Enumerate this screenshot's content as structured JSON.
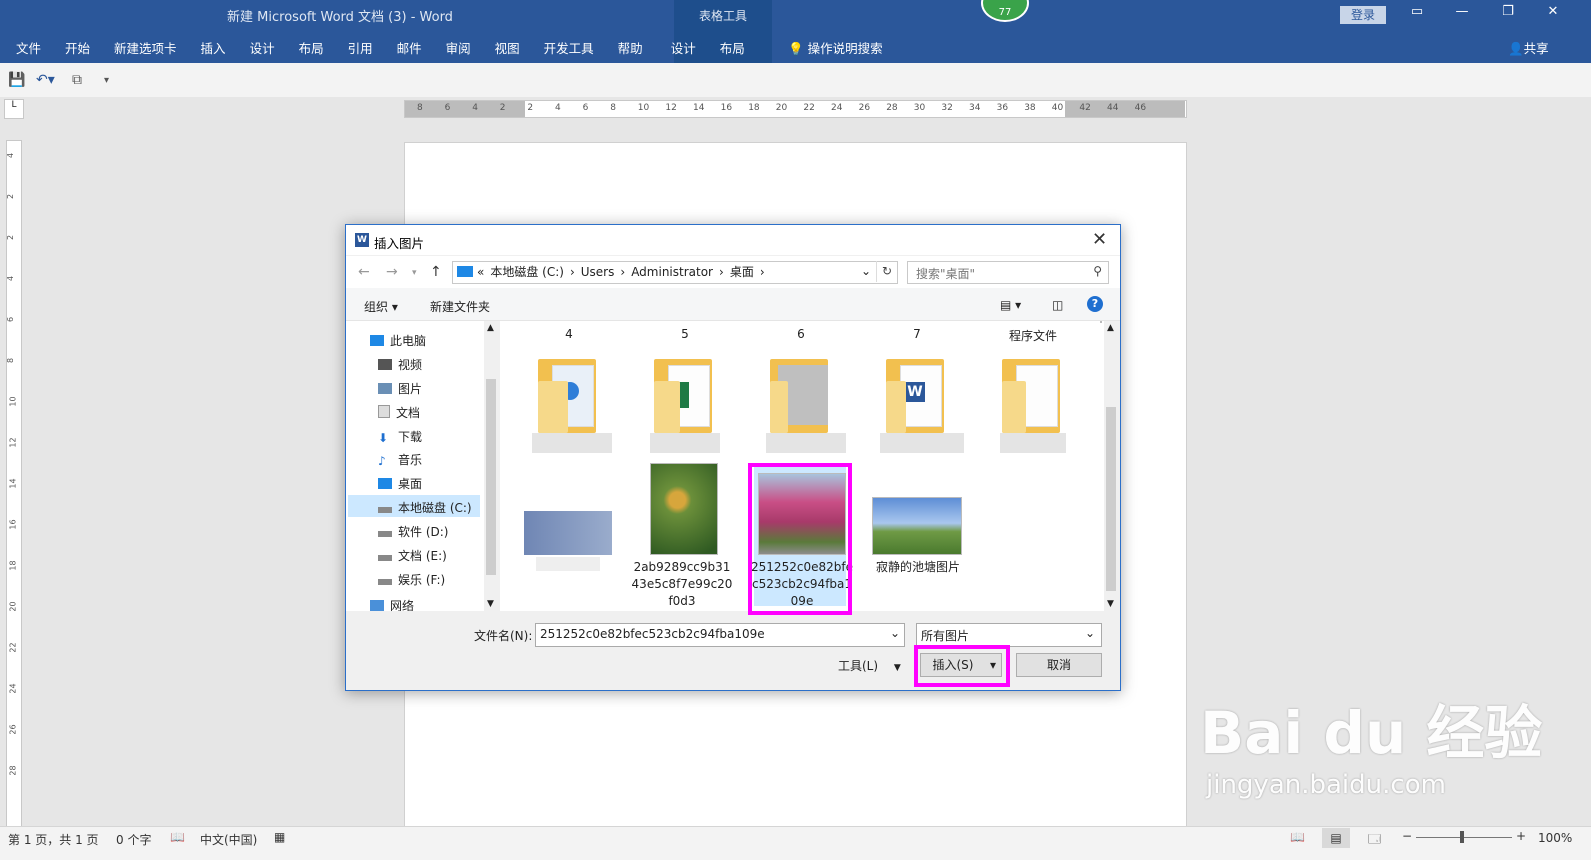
{
  "window": {
    "title": "新建 Microsoft Word 文档 (3)  -  Word",
    "context_tab_group": "表格工具",
    "login": "登录",
    "share": "共享",
    "badge": "77"
  },
  "ribbon": {
    "tabs": [
      "文件",
      "开始",
      "新建选项卡",
      "插入",
      "设计",
      "布局",
      "引用",
      "邮件",
      "审阅",
      "视图",
      "开发工具",
      "帮助",
      "设计",
      "布局"
    ],
    "tell_me": "操作说明搜索"
  },
  "ruler": {
    "h_numbers": [
      "8",
      "6",
      "4",
      "2",
      "2",
      "4",
      "6",
      "8",
      "10",
      "12",
      "14",
      "16",
      "18",
      "20",
      "22",
      "24",
      "26",
      "28",
      "30",
      "32",
      "34",
      "36",
      "38",
      "40",
      "42",
      "44",
      "46"
    ],
    "v_numbers": [
      "4",
      "2",
      "2",
      "4",
      "6",
      "8",
      "10",
      "12",
      "14",
      "16",
      "18",
      "20",
      "22",
      "24",
      "26",
      "28"
    ]
  },
  "dialog": {
    "title": "插入图片",
    "breadcrumb": [
      "«",
      "本地磁盘 (C:)",
      "›",
      "Users",
      "›",
      "Administrator",
      "›",
      "桌面",
      "›"
    ],
    "search_placeholder": "搜索\"桌面\"",
    "organize": "组织 ▾",
    "new_folder": "新建文件夹",
    "nav_items": [
      "此电脑",
      "视频",
      "图片",
      "文档",
      "下载",
      "音乐",
      "桌面",
      "本地磁盘 (C:)",
      "软件 (D:)",
      "文档 (E:)",
      "娱乐 (F:)",
      "网络"
    ],
    "selected_nav": "本地磁盘 (C:)",
    "folders": [
      "4",
      "5",
      "6",
      "7",
      "程序文件"
    ],
    "images": [
      {
        "name": "2ab9289cc9b3143e5c8f7e99c20f0d3"
      },
      {
        "name": "251252c0e82bfec523cb2c94fba109e"
      },
      {
        "name": "寂静的池塘图片"
      }
    ],
    "filename_label": "文件名(N):",
    "filename_value": "251252c0e82bfec523cb2c94fba109e",
    "filetype": "所有图片",
    "tools": "工具(L)",
    "insert": "插入(S)",
    "cancel": "取消"
  },
  "status": {
    "page": "第 1 页，共 1 页",
    "words": "0 个字",
    "language": "中文(中国)",
    "zoom": "100%"
  },
  "watermark": {
    "brand": "Bai du 经验",
    "url": "jingyan.baidu.com"
  },
  "colors": {
    "word_blue": "#2b579a",
    "highlight": "#ff00ff",
    "selection": "#cce8ff"
  }
}
